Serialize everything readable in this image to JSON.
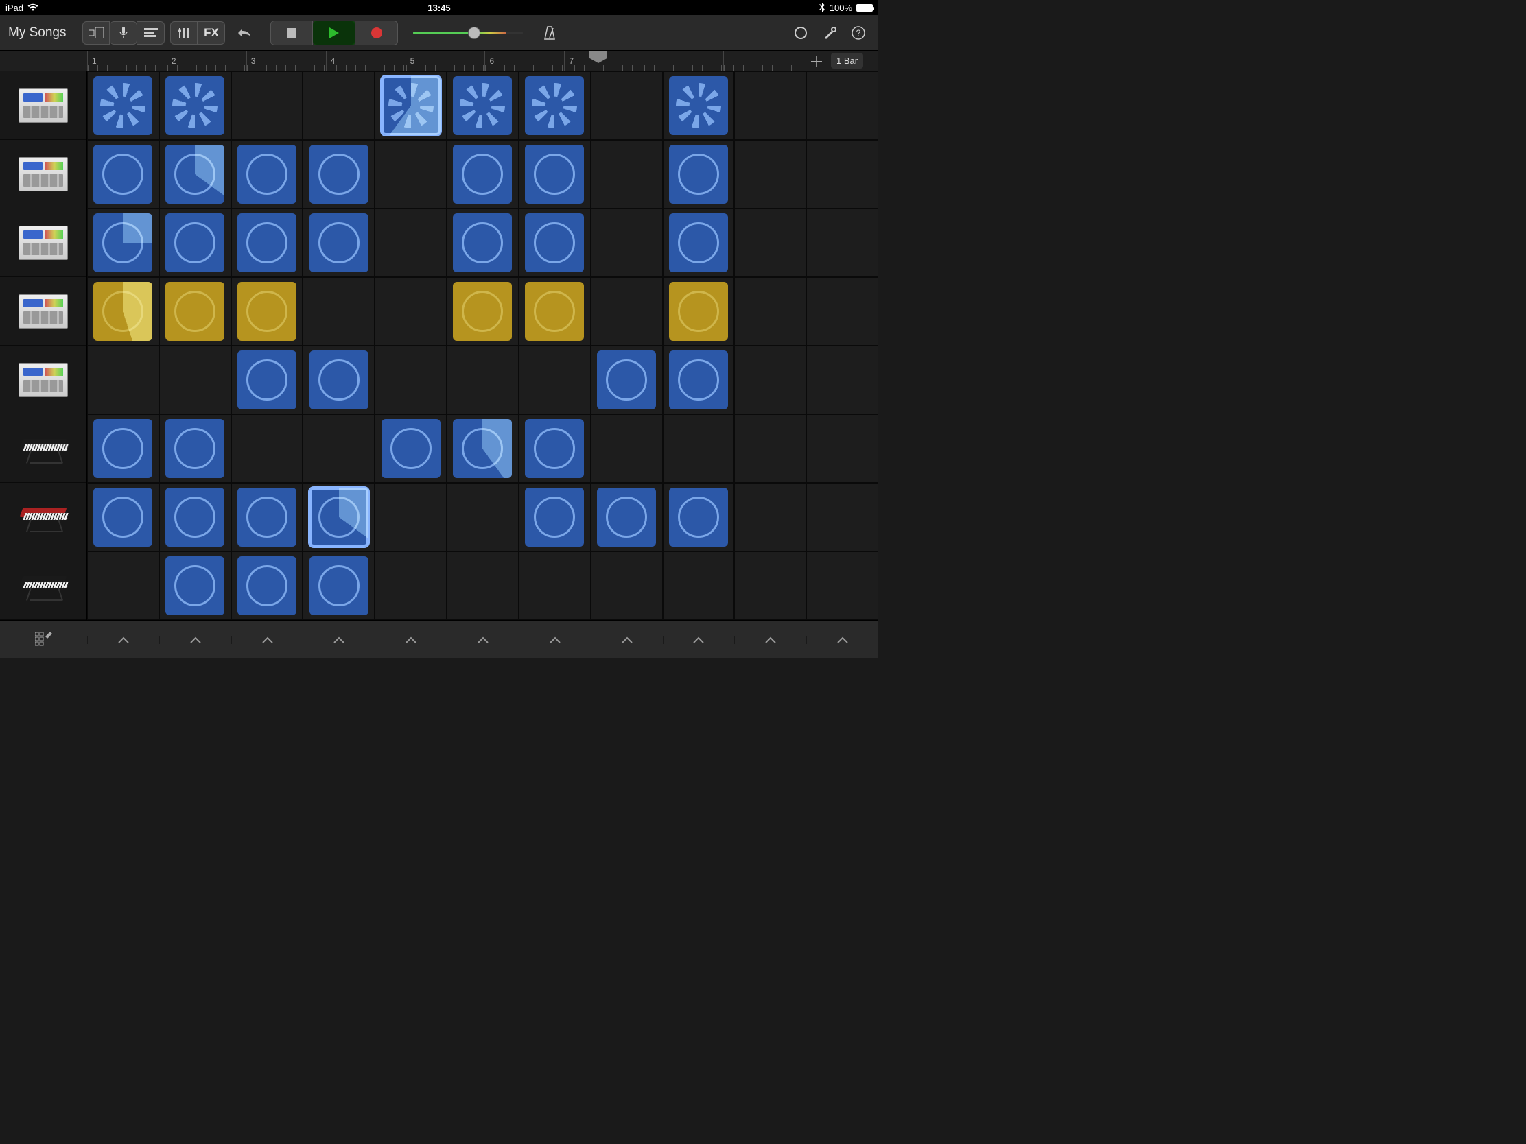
{
  "status": {
    "device": "iPad",
    "time": "13:45",
    "battery_pct": "100%"
  },
  "toolbar": {
    "title": "My Songs",
    "fx_label": "FX"
  },
  "ruler": {
    "bars": [
      "1",
      "2",
      "3",
      "4",
      "5",
      "6",
      "7"
    ],
    "playhead_bar": 6,
    "zoom_label": "1 Bar"
  },
  "tracks": [
    {
      "type": "drum"
    },
    {
      "type": "drum"
    },
    {
      "type": "drum"
    },
    {
      "type": "drum"
    },
    {
      "type": "drum"
    },
    {
      "type": "keyboard",
      "variant": "dark"
    },
    {
      "type": "keyboard",
      "variant": "red"
    },
    {
      "type": "keyboard",
      "variant": "dark"
    }
  ],
  "grid": {
    "cols": 11,
    "rows": 8,
    "cells": [
      {
        "r": 0,
        "c": 0,
        "color": "blue",
        "pattern": "burst"
      },
      {
        "r": 0,
        "c": 1,
        "color": "blue",
        "pattern": "burst"
      },
      {
        "r": 0,
        "c": 4,
        "color": "blue",
        "pattern": "burst",
        "selected": true,
        "progress": 60
      },
      {
        "r": 0,
        "c": 5,
        "color": "blue",
        "pattern": "burst"
      },
      {
        "r": 0,
        "c": 6,
        "color": "blue",
        "pattern": "burst"
      },
      {
        "r": 0,
        "c": 8,
        "color": "blue",
        "pattern": "burst"
      },
      {
        "r": 1,
        "c": 0,
        "color": "blue",
        "pattern": "ring"
      },
      {
        "r": 1,
        "c": 1,
        "color": "blue",
        "pattern": "ring",
        "progress": 35
      },
      {
        "r": 1,
        "c": 2,
        "color": "blue",
        "pattern": "ring"
      },
      {
        "r": 1,
        "c": 3,
        "color": "blue",
        "pattern": "ring"
      },
      {
        "r": 1,
        "c": 5,
        "color": "blue",
        "pattern": "ring"
      },
      {
        "r": 1,
        "c": 6,
        "color": "blue",
        "pattern": "ring"
      },
      {
        "r": 1,
        "c": 8,
        "color": "blue",
        "pattern": "ring"
      },
      {
        "r": 2,
        "c": 0,
        "color": "blue",
        "pattern": "ring",
        "progress": 25
      },
      {
        "r": 2,
        "c": 1,
        "color": "blue",
        "pattern": "ring"
      },
      {
        "r": 2,
        "c": 2,
        "color": "blue",
        "pattern": "ring"
      },
      {
        "r": 2,
        "c": 3,
        "color": "blue",
        "pattern": "ring"
      },
      {
        "r": 2,
        "c": 5,
        "color": "blue",
        "pattern": "ring"
      },
      {
        "r": 2,
        "c": 6,
        "color": "blue",
        "pattern": "ring"
      },
      {
        "r": 2,
        "c": 8,
        "color": "blue",
        "pattern": "ring"
      },
      {
        "r": 3,
        "c": 0,
        "color": "yellow",
        "pattern": "ring",
        "progress": 45
      },
      {
        "r": 3,
        "c": 1,
        "color": "yellow",
        "pattern": "ring"
      },
      {
        "r": 3,
        "c": 2,
        "color": "yellow",
        "pattern": "ring"
      },
      {
        "r": 3,
        "c": 5,
        "color": "yellow",
        "pattern": "ring"
      },
      {
        "r": 3,
        "c": 6,
        "color": "yellow",
        "pattern": "ring"
      },
      {
        "r": 3,
        "c": 8,
        "color": "yellow",
        "pattern": "ring"
      },
      {
        "r": 4,
        "c": 2,
        "color": "blue",
        "pattern": "ring"
      },
      {
        "r": 4,
        "c": 3,
        "color": "blue",
        "pattern": "ring"
      },
      {
        "r": 4,
        "c": 7,
        "color": "blue",
        "pattern": "ring"
      },
      {
        "r": 4,
        "c": 8,
        "color": "blue",
        "pattern": "ring"
      },
      {
        "r": 5,
        "c": 0,
        "color": "blue",
        "pattern": "ring"
      },
      {
        "r": 5,
        "c": 1,
        "color": "blue",
        "pattern": "ring"
      },
      {
        "r": 5,
        "c": 4,
        "color": "blue",
        "pattern": "ring"
      },
      {
        "r": 5,
        "c": 5,
        "color": "blue",
        "pattern": "ring",
        "progress": 40
      },
      {
        "r": 5,
        "c": 6,
        "color": "blue",
        "pattern": "ring"
      },
      {
        "r": 6,
        "c": 0,
        "color": "blue",
        "pattern": "ring"
      },
      {
        "r": 6,
        "c": 1,
        "color": "blue",
        "pattern": "ring"
      },
      {
        "r": 6,
        "c": 2,
        "color": "blue",
        "pattern": "ring"
      },
      {
        "r": 6,
        "c": 3,
        "color": "blue",
        "pattern": "ring",
        "selected": true,
        "progress": 35
      },
      {
        "r": 6,
        "c": 6,
        "color": "blue",
        "pattern": "ring"
      },
      {
        "r": 6,
        "c": 7,
        "color": "blue",
        "pattern": "ring"
      },
      {
        "r": 6,
        "c": 8,
        "color": "blue",
        "pattern": "ring"
      },
      {
        "r": 7,
        "c": 1,
        "color": "blue",
        "pattern": "ring"
      },
      {
        "r": 7,
        "c": 2,
        "color": "blue",
        "pattern": "ring"
      },
      {
        "r": 7,
        "c": 3,
        "color": "blue",
        "pattern": "ring"
      }
    ]
  }
}
